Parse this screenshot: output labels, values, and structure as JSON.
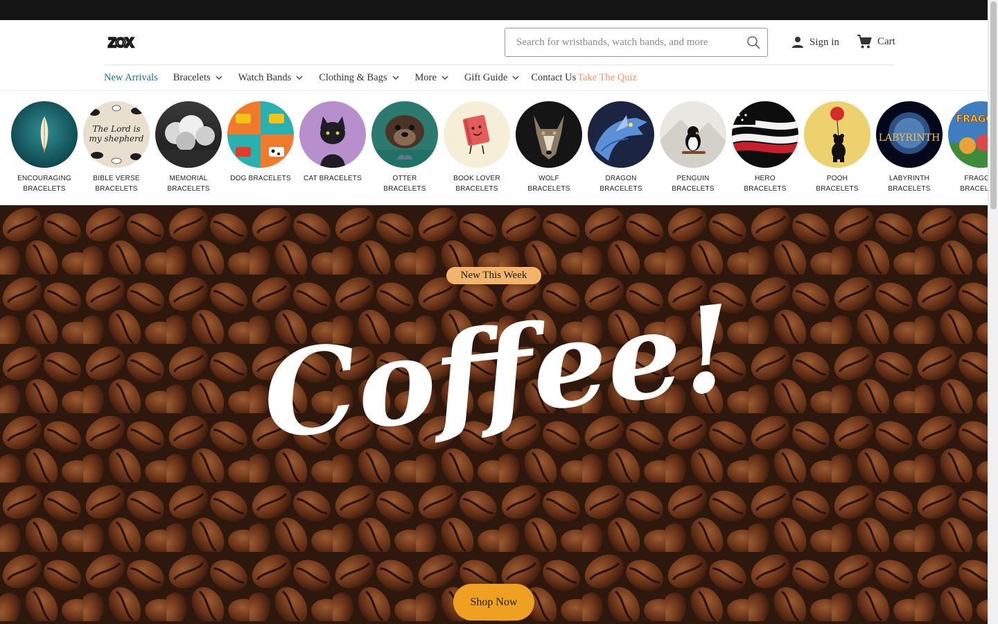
{
  "header": {
    "logo_text": "ZOX",
    "search_placeholder": "Search for wristbands, watch bands, and more",
    "signin_label": "Sign in",
    "cart_label": "Cart"
  },
  "nav": {
    "items": [
      {
        "label": "New Arrivals"
      },
      {
        "label": "Bracelets"
      },
      {
        "label": "Watch Bands"
      },
      {
        "label": "Clothing & Bags"
      },
      {
        "label": "More"
      },
      {
        "label": "Gift Guide"
      },
      {
        "label": "Contact Us"
      },
      {
        "label": "Take The Quiz"
      }
    ]
  },
  "categories": [
    {
      "label": "ENCOURAGING BRACELETS"
    },
    {
      "label": "BIBLE VERSE BRACELETS",
      "image_text": "The Lord is my shepherd"
    },
    {
      "label": "MEMORIAL BRACELETS"
    },
    {
      "label": "DOG BRACELETS"
    },
    {
      "label": "CAT BRACELETS"
    },
    {
      "label": "OTTER BRACELETS"
    },
    {
      "label": "BOOK LOVER BRACELETS"
    },
    {
      "label": "WOLF BRACELETS"
    },
    {
      "label": "DRAGON BRACELETS"
    },
    {
      "label": "PENGUIN BRACELETS"
    },
    {
      "label": "HERO BRACELETS"
    },
    {
      "label": "POOH BRACELETS"
    },
    {
      "label": "LABYRINTH BRACELETS",
      "image_text": "LABYRINTH"
    },
    {
      "label": "FRAGGLE BRACELETS",
      "image_text": "FRAGGLE"
    }
  ],
  "hero": {
    "badge": "New This Week",
    "title": "Coffee!",
    "cta": "Shop Now"
  },
  "colors": {
    "topbar": "#141414",
    "nav_accent": "#1a6f82",
    "quiz": "#f0956a",
    "badge": "#f2b46a",
    "cta": "#f0a020"
  },
  "icons": {
    "search": "search-icon",
    "account": "person-icon",
    "cart": "cart-icon",
    "dropdown": "chevron-down-icon"
  }
}
